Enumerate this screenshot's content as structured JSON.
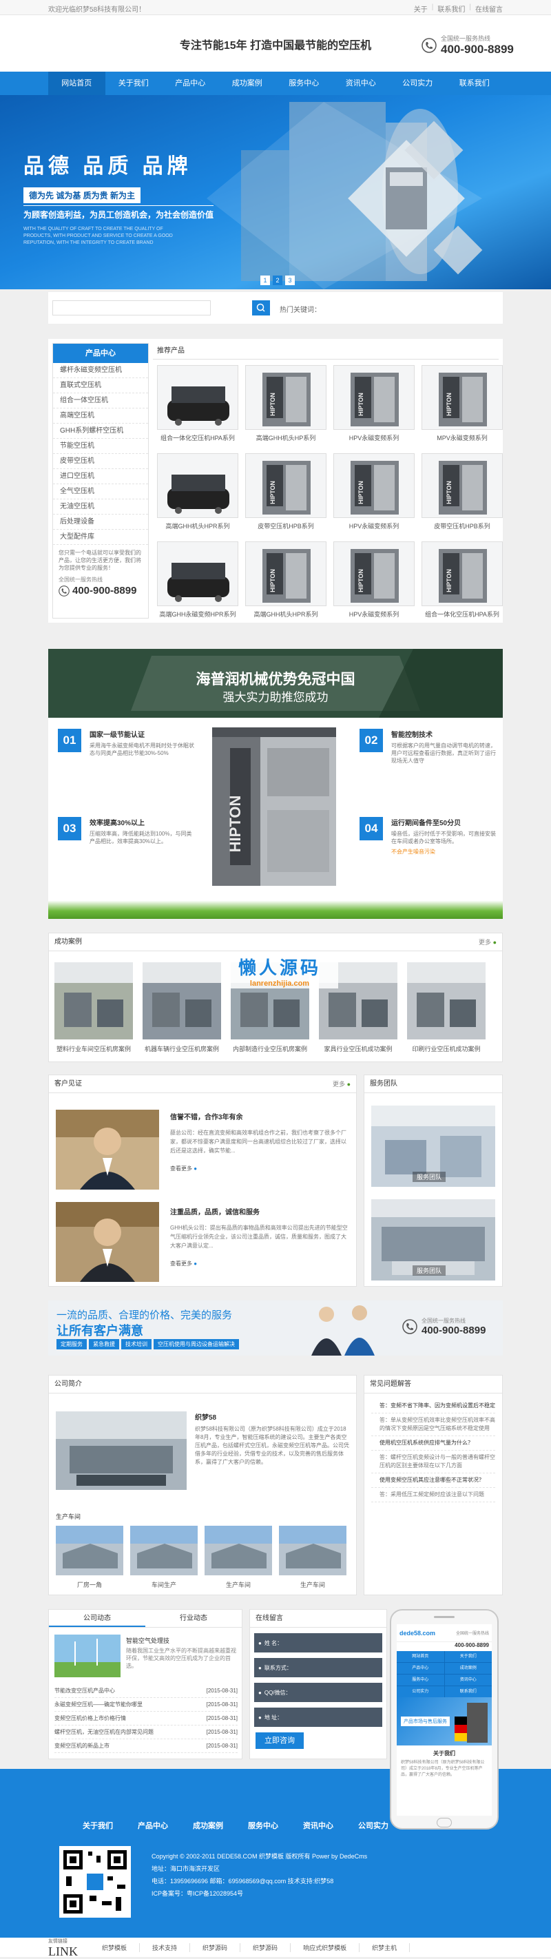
{
  "topbar": {
    "welcome": "欢迎光临织梦58科技有限公司！",
    "links": [
      "关于",
      "联系我们",
      "在线留言"
    ]
  },
  "header": {
    "slogan": "专注节能15年 打造中国最节能的空压机",
    "phone_label": "全国统一服务热线",
    "phone": "400-900-8899"
  },
  "nav": [
    "网站首页",
    "关于我们",
    "产品中心",
    "成功案例",
    "服务中心",
    "资讯中心",
    "公司实力",
    "联系我们"
  ],
  "banner": {
    "title": "品德  品质  品牌",
    "tags": "德为先  诚为基  质为贵  新为主",
    "line": "为顾客创造利益，为员工创造机会，为社会创造价值",
    "en": "WITH THE QUALITY OF CRAFT TO CREATE THE QUALITY OF PRODUCTS, WITH PRODUCT AND SERVICE TO CREATE A GOOD REPUTATION, WITH THE INTEGRITY TO CREATE BRAND",
    "dots": [
      "1",
      "2",
      "3"
    ]
  },
  "search": {
    "hot": "热门关键词："
  },
  "sidebar": {
    "title": "产品中心",
    "items": [
      "螺杆永磁变频空压机",
      "直联式空压机",
      "组合一体空压机",
      "高端空压机",
      "GHH系列螺杆空压机",
      "节能空压机",
      "皮带空压机",
      "进口空压机",
      "全气空压机",
      "无油空压机",
      "后处理设备",
      "大型配件库"
    ],
    "desc": "您只需一个电话就可以享受我们的产品，让您的生活更方便，我们将为您提供专业的服务！",
    "phone_label": "全国统一服务热线",
    "phone": "400-900-8899"
  },
  "products": {
    "title": "推荐产品",
    "items": [
      "组合一体化空压机HPA系列",
      "高端GHH机头HP系列",
      "HPV永磁变频系列",
      "MPV永磁变频系列",
      "高端GHH机头HPR系列",
      "皮带空压机HPB系列",
      "HPV永磁变频系列",
      "皮带空压机HPB系列",
      "高端GHH永磁变频HPR系列",
      "高端GHH机头HPR系列",
      "HPV永磁变频系列",
      "组合一体化空压机HPA系列"
    ]
  },
  "ad": {
    "h1": "海普润机械优势免冠中国",
    "h2": "强大实力助推您成功",
    "features": [
      {
        "no": "01",
        "title": "国家一级节能认证",
        "desc": "采用海牛永磁变频电机不用耗时处于休眠状态与同类产品相比节能30%-50%"
      },
      {
        "no": "02",
        "title": "智能控制技术",
        "desc": "可根据客户的用气量自动调节电机的转速，用户可远程查看运行数据，真正听到了运行现场无人值守"
      },
      {
        "no": "03",
        "title": "效率提高30%以上",
        "desc": "压缩效率高，降低能耗达到100%，与同类产品相比，效率提高30%以上。"
      },
      {
        "no": "04",
        "title": "运行期间备件至50分贝",
        "desc": "噪音低，运行时低于不受影响，可直接安装在车间或者办公室等场所。",
        "note": "不会产生噪音污染"
      }
    ]
  },
  "watermark": {
    "cn": "懒人源码",
    "en": "lanrenzhijia.com"
  },
  "cases": {
    "title": "成功案例",
    "more": "更多",
    "items": [
      "塑料行业车间空压机房案例",
      "机器车辆行业空压机房案例",
      "内部制造行业空压机房案例",
      "家具行业空压机成功案例",
      "印刷行业空压机成功案例"
    ]
  },
  "testimonials": {
    "title": "客户见证",
    "more": "更多",
    "items": [
      {
        "head": "信誉不错，合作3年有余",
        "text": "薛总公司：经在直流变频和高效率机组合作之前，我们也考察了很多个厂家，都说不惊豪客户满意度和同一台高速机组综合比较过了厂家，选择以后还是这选择，确实节能...",
        "more": "查看更多"
      },
      {
        "head": "注重品质，品质，诚信和服务",
        "text": "GHH机头公司：提出有品质的事物品质和高效率公司提出先进的节能型空气压缩机行业领先企业，该公司注重品质，诚信，质量和服务，图成了大大客户满意认定...",
        "more": "查看更多"
      }
    ]
  },
  "service": {
    "title": "服务团队",
    "items": [
      "服务团队",
      "服务团队"
    ]
  },
  "promo": {
    "line1": "一流的品质、合理的价格、完美的服务",
    "line2": "让所有客户满意",
    "tags": [
      "定期服务",
      "紧急救援",
      "技术培训",
      "空压机使用与周边设备运输解决"
    ],
    "phone_label": "全国统一服务热线",
    "phone": "400-900-8899"
  },
  "about": {
    "title": "公司简介",
    "name": "织梦58",
    "text": "织梦58科技有限公司（原为织梦58科技有限公司）成立于2018年8月，专业生产，智能压缩系统的建设公司。主要生产各类空压机产品，包括螺杆式空压机，永磁变频空压机等产品。公司凭借多年的行业经验，凭借专业的技术，以及完善的售后服务体系，赢得了广大客户的信赖。",
    "workshop_title": "生产车间",
    "workshop": [
      "厂房一角",
      "车间生产",
      "生产车间",
      "生产车间"
    ]
  },
  "faq": {
    "title": "常见问题解答",
    "items": [
      {
        "q": "答：变频不省下降率、因为变频机设置后不稳定",
        "a": ""
      },
      {
        "q": "答：单从变频空压机效率比变频空压机效率不高的情况下变频原因是空气压缩系统不稳定使用",
        "a": ""
      },
      {
        "q": "使用机空压机系统供应排气量为什么？",
        "a": ""
      },
      {
        "q": "答：螺杆空压机变频设计与一般的普通有螺杆空压机的区别主要体现在以下几方面",
        "a": ""
      },
      {
        "q": "使用变频空压机其应注意哪些不正常状况？",
        "a": ""
      },
      {
        "q": "答：采用低压工频定频时应该注意以下问题",
        "a": ""
      }
    ]
  },
  "news": {
    "tabs": [
      "公司动态",
      "行业动态"
    ],
    "feature": {
      "title": "智能空气处理技",
      "text": "随着我国工业生产水平的不断提高越来越重视环保，节能又高效的空压机成为了企业的首选。"
    },
    "items": [
      {
        "t": "节能改变空压机产品中心",
        "d": "[2015-08-31]"
      },
      {
        "t": "永磁变频空压机——确定节能你哪里",
        "d": "[2015-08-31]"
      },
      {
        "t": "变频空压机价格上市价格行情",
        "d": "[2015-08-31]"
      },
      {
        "t": "螺杆空压机，无油空压机在内部常见问题",
        "d": "[2015-08-31]"
      },
      {
        "t": "变频空压机的新品上市",
        "d": "[2015-08-31]"
      }
    ]
  },
  "message": {
    "title": "在线留言",
    "fields": [
      "姓 名：",
      "联系方式：",
      "QQ/微信：",
      "地 址："
    ],
    "submit": "立即咨询"
  },
  "mobile": {
    "logo": "dede58.com",
    "phone_label": "全国统一服务热线",
    "phone": "400-900-8899",
    "menu": [
      "网站首页",
      "关于我们",
      "产品中心",
      "成功案例",
      "服务中心",
      "资讯中心",
      "公司实力",
      "联系我们"
    ],
    "banner": "产品市场与售后服务",
    "about_title": "关于我们",
    "about_text": "织梦58科技有限公司（原为织梦58科技有限公司）成立于2018年8月，专业生产空压机等产品，赢得了广大客户的信赖。"
  },
  "footer": {
    "nav": [
      "关于我们",
      "产品中心",
      "成功案例",
      "服务中心",
      "资讯中心",
      "公司实力"
    ],
    "copyright": "Copyright © 2002-2011 DEDE58.COM 织梦模板 版权所有 Power by DedeCms",
    "address": "地址：海口市海滨开发区",
    "contact": "电话：13959696696 邮箱：695968569@qq.com 技术支持:织梦58",
    "icp": "ICP备案号：粤ICP备12028954号"
  },
  "flinks": {
    "title": "友情链接",
    "en": "LINK",
    "items": [
      "织梦模板",
      "技术支持",
      "织梦源码",
      "织梦源码",
      "响应式织梦模板",
      "织梦主机"
    ]
  },
  "colors": {
    "primary": "#1a83d9",
    "dark": "#0f6cbd",
    "orange": "#f08c1a",
    "green": "#4f9a25"
  }
}
